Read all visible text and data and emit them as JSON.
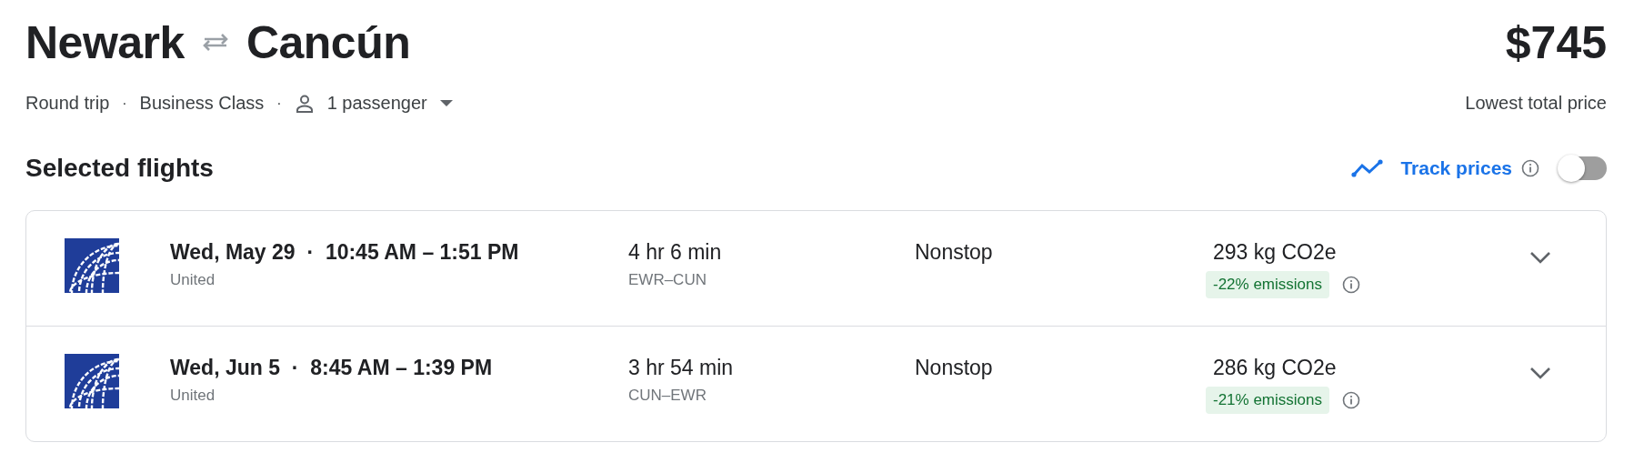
{
  "header": {
    "origin": "Newark",
    "destination": "Cancún",
    "price": "$745",
    "price_caption": "Lowest total price"
  },
  "options": {
    "trip_type": "Round trip",
    "cabin": "Business Class",
    "passengers": "1 passenger",
    "separators": [
      "·",
      "·"
    ]
  },
  "section": {
    "title": "Selected flights",
    "track_prices": {
      "label": "Track prices",
      "on": false
    }
  },
  "flights": [
    {
      "date": "Wed, May 29",
      "separator": "·",
      "times": "10:45 AM – 1:51 PM",
      "airline": "United",
      "duration": "4 hr 6 min",
      "route": "EWR–CUN",
      "stops": "Nonstop",
      "emissions": "293 kg CO2e",
      "emissions_badge": "-22% emissions",
      "expanded": false
    },
    {
      "date": "Wed, Jun 5",
      "separator": "·",
      "times": "8:45 AM – 1:39 PM",
      "airline": "United",
      "duration": "3 hr 54 min",
      "route": "CUN–EWR",
      "stops": "Nonstop",
      "emissions": "286 kg CO2e",
      "emissions_badge": "-21% emissions",
      "expanded": false
    }
  ]
}
